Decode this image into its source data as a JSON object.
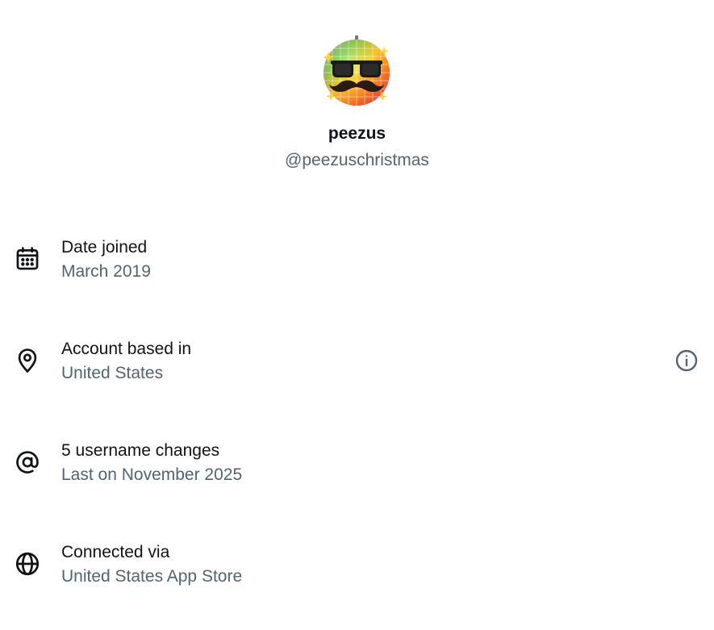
{
  "profile": {
    "avatar": "disco-ball-mustache-glasses-emoji",
    "display_name": "peezus",
    "handle": "@peezuschristmas"
  },
  "details": [
    {
      "icon": "calendar-icon",
      "label": "Date joined",
      "value": "March 2019"
    },
    {
      "icon": "location-pin-icon",
      "label": "Account based in",
      "value": "United States",
      "has_info": true
    },
    {
      "icon": "at-sign-icon",
      "label": "5 username changes",
      "value": "Last on November 2025"
    },
    {
      "icon": "globe-icon",
      "label": "Connected via",
      "value": "United States App Store"
    }
  ],
  "colors": {
    "primary_text": "#0f1419",
    "secondary_text": "#536471"
  }
}
